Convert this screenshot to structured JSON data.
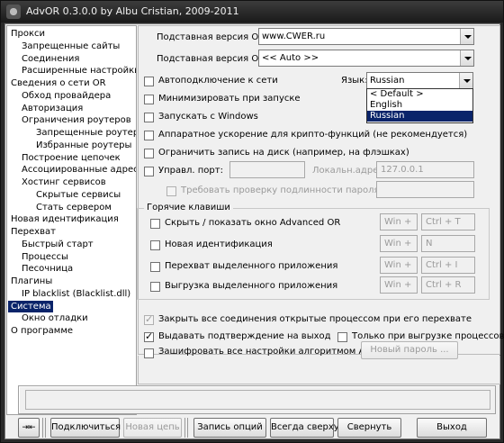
{
  "window": {
    "title": "AdvOR  0.3.0.0 by Albu Cristian, 2009-2011"
  },
  "tree": [
    {
      "label": "Прокси",
      "selected": false
    },
    {
      "label": "Запрещенные сайты",
      "selected": false
    },
    {
      "label": "Соединения",
      "selected": false
    },
    {
      "label": "Расширенные настройки пр",
      "selected": false
    },
    {
      "label": "Сведения о сети OR",
      "selected": false
    },
    {
      "label": "Обход провайдера",
      "selected": false
    },
    {
      "label": "Авторизация",
      "selected": false
    },
    {
      "label": "Ограничения роутеров",
      "selected": false
    },
    {
      "label": "Запрещенные роутеры",
      "selected": false
    },
    {
      "label": "Избранные роутеры",
      "selected": false
    },
    {
      "label": "Построение цепочек",
      "selected": false
    },
    {
      "label": "Ассоциированные адреса",
      "selected": false
    },
    {
      "label": "Хостинг сервисов",
      "selected": false
    },
    {
      "label": "Скрытые сервисы",
      "selected": false
    },
    {
      "label": "Стать сервером",
      "selected": false
    },
    {
      "label": "Новая идентификация",
      "selected": false
    },
    {
      "label": "Перехват",
      "selected": false
    },
    {
      "label": "Быстрый старт",
      "selected": false
    },
    {
      "label": "Процессы",
      "selected": false
    },
    {
      "label": "Песочница",
      "selected": false
    },
    {
      "label": "Плагины",
      "selected": false
    },
    {
      "label": "IP blacklist (Blacklist.dll)",
      "selected": false
    },
    {
      "label": "Система",
      "selected": true
    },
    {
      "label": "Окно отладки",
      "selected": false
    },
    {
      "label": "О программе",
      "selected": false
    }
  ],
  "settings": {
    "fake_os_label": "Подставная версия ОС:",
    "fake_os_value": "www.CWER.ru",
    "fake_or_label": "Подставная версия OR:",
    "fake_or_value": "<< Auto >>",
    "language_label": "Язык:",
    "language_value": "Russian",
    "language_options": [
      "< Default >",
      "English",
      "Russian"
    ],
    "autoconnect": {
      "label": "Автоподключение к сети",
      "checked": false
    },
    "minimize": {
      "label": "Минимизировать при запуске",
      "checked": false
    },
    "start_windows": {
      "label": "Запускать с Windows",
      "checked": false
    },
    "hw_accel": {
      "label": "Аппаратное ускорение для крипто-функций (не рекомендуется)",
      "checked": false
    },
    "limit_disk": {
      "label": "Ограничить запись на диск (например, на флэшках)",
      "checked": false
    },
    "ctrl_port": {
      "label": "Управл. порт:",
      "checked": false,
      "value": ""
    },
    "local_addr_label": "Локальн.адрес:",
    "local_addr_value": "127.0.0.1",
    "require_password": {
      "label": "Требовать проверку подлинности пароля:",
      "checked": false,
      "value": ""
    }
  },
  "hotkeys": {
    "title": "Горячие клавиши",
    "items": [
      {
        "label": "Скрыть / показать окно Advanced OR",
        "mod": "Win +",
        "key": "Ctrl + T"
      },
      {
        "label": "Новая идентификация",
        "mod": "Win +",
        "key": "N"
      },
      {
        "label": "Перехват выделенного приложения",
        "mod": "Win +",
        "key": "Ctrl + I"
      },
      {
        "label": "Выгрузка выделенного приложения",
        "mod": "Win +",
        "key": "Ctrl + R"
      }
    ]
  },
  "bottom_options": {
    "close_connections": {
      "label": "Закрыть все соединения открытые процессом при его перехвате",
      "checked": true
    },
    "confirm_exit": {
      "label": "Выдавать подтверждение на выход",
      "checked": true
    },
    "only_on_unload": {
      "label": "Только при выгрузке процессов",
      "checked": false
    },
    "encrypt_settings": {
      "label": "Зашифровать все настройки алгоритмом AES",
      "checked": false
    },
    "new_password_button": "Новый пароль ..."
  },
  "toolbar": {
    "connect": "Подключиться",
    "new_chain": "Новая цепь",
    "save_options": "Запись опций",
    "always_on_top": "Всегда сверху",
    "minimize": "Свернуть",
    "exit": "Выход"
  }
}
